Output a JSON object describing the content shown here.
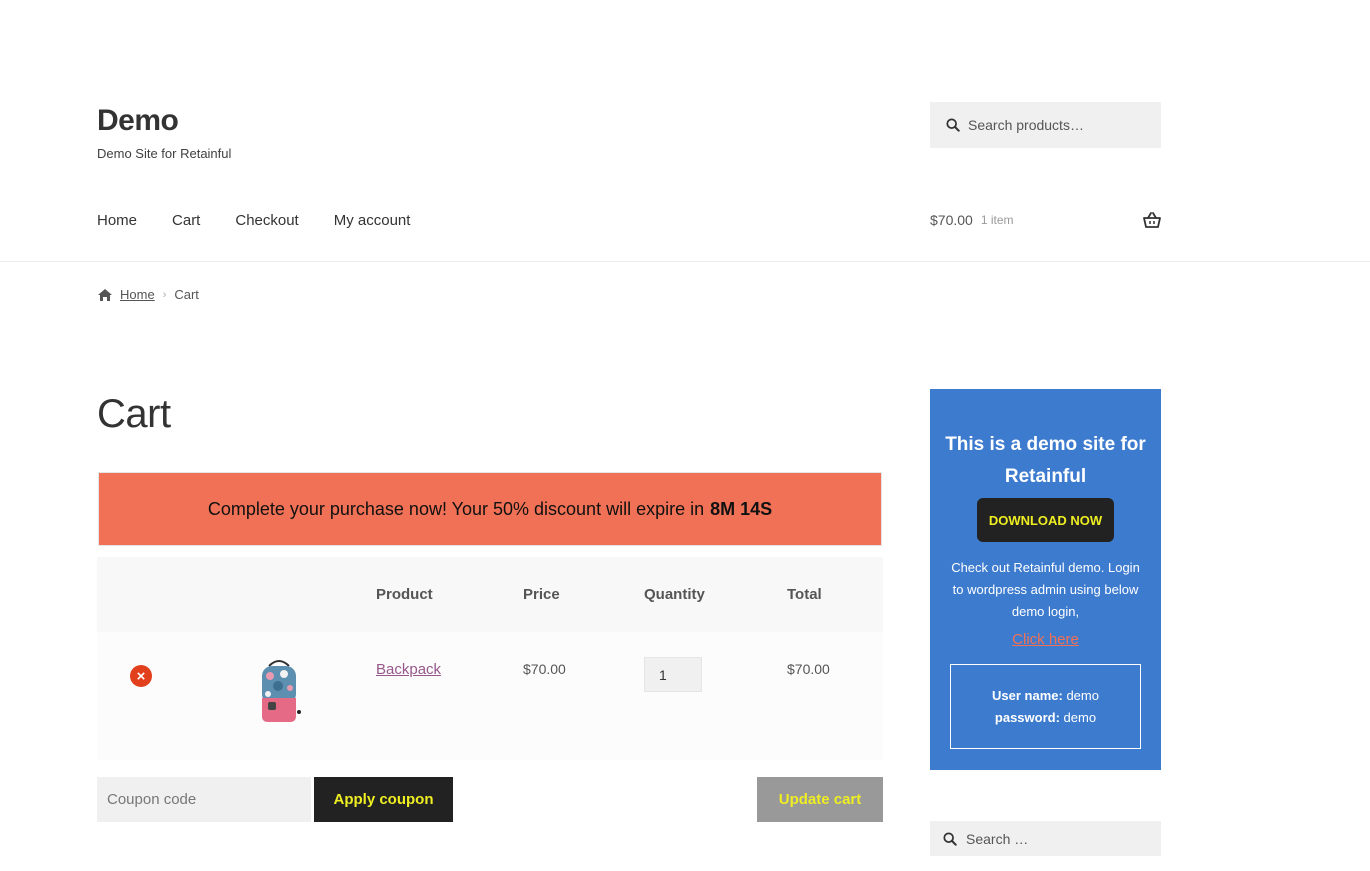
{
  "site": {
    "title": "Demo",
    "description": "Demo Site for Retainful"
  },
  "header": {
    "search_placeholder": "Search products…",
    "nav": [
      "Home",
      "Cart",
      "Checkout",
      "My account"
    ],
    "cart_amount": "$70.00",
    "cart_count": "1 item"
  },
  "breadcrumb": {
    "home": "Home",
    "current": "Cart"
  },
  "page_title": "Cart",
  "countdown": {
    "message": "Complete your purchase now! Your 50% discount will expire in",
    "time": "8M 14S",
    "background_color": "#f07155"
  },
  "cart": {
    "headers": {
      "product": "Product",
      "price": "Price",
      "quantity": "Quantity",
      "total": "Total"
    },
    "items": [
      {
        "name": "Backpack",
        "price": "$70.00",
        "quantity": "1",
        "total": "$70.00"
      }
    ],
    "coupon_placeholder": "Coupon code",
    "apply_label": "Apply coupon",
    "update_label": "Update cart"
  },
  "promo": {
    "title": "This is a demo site for Retainful",
    "download_label": "DOWNLOAD NOW",
    "text": "Check out Retainful demo. Login to wordpress admin using below demo login,",
    "link_label": "Click here",
    "username_label": "User name:",
    "username": "demo",
    "password_label": "password:",
    "password": "demo",
    "background_color": "#3d7bcf"
  },
  "sidebar": {
    "search_placeholder": "Search …"
  },
  "colors": {
    "accent_button": "#222222",
    "button_text": "#eeee22",
    "link": "#96588a",
    "remove": "#e2401c"
  }
}
